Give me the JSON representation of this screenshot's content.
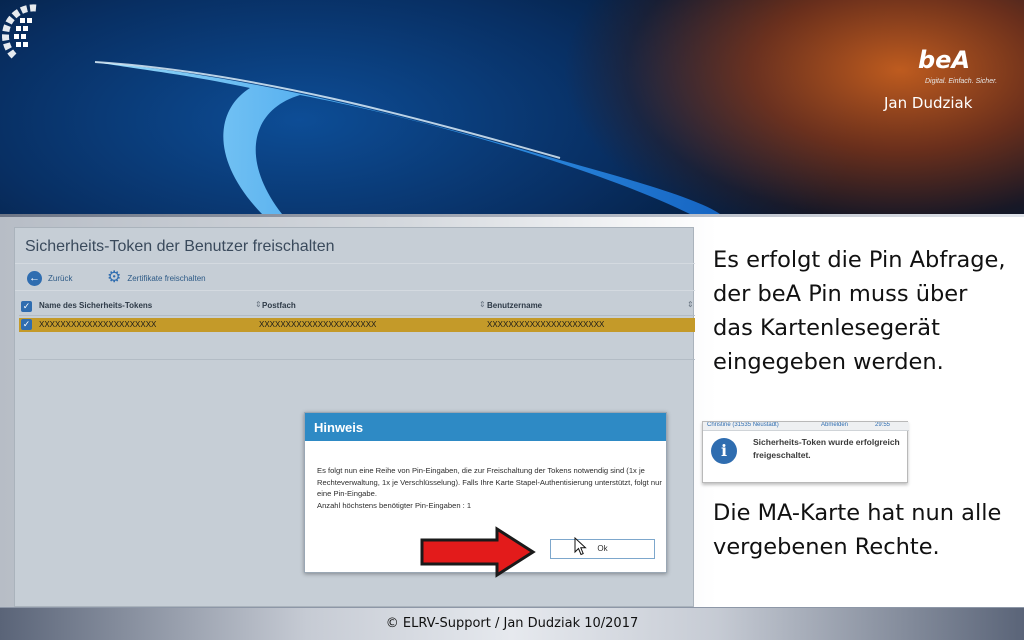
{
  "brand": {
    "logo_text": "beA",
    "tagline": "Digital. Einfach. Sicher.",
    "author": "Jan Dudziak"
  },
  "app": {
    "title": "Sicherheits-Token der Benutzer freischalten",
    "toolbar": {
      "back_label": "Zurück",
      "unlock_label": "Zertifikate freischalten"
    },
    "grid": {
      "columns": [
        "Name des Sicherheits-Tokens",
        "Postfach",
        "Benutzername"
      ],
      "rows": [
        [
          "XXXXXXXXXXXXXXXXXXXXXX",
          "XXXXXXXXXXXXXXXXXXXXXX",
          "XXXXXXXXXXXXXXXXXXXXXX"
        ]
      ]
    }
  },
  "dialog": {
    "title": "Hinweis",
    "body": "Es folgt nun eine Reihe von Pin-Eingaben, die zur Freischaltung der Tokens notwendig sind (1x je Rechteverwaltung, 1x je Verschlüsselung). Falls Ihre Karte Stapel-Authentisierung unterstützt, folgt nur eine Pin-Eingabe.",
    "count_line": "Anzahl höchstens benötigter Pin-Eingaben : 1",
    "ok_label": "Ok"
  },
  "notification": {
    "top_user": "Christine (31535 Neustadt)",
    "top_logout": "Abmelden",
    "top_time": "29:55",
    "message": "Sicherheits-Token wurde erfolgreich freigeschaltet."
  },
  "slide": {
    "text_pin": "Es erfolgt die Pin Abfrage, der beA Pin muss über das Kartenlesegerät eingegeben werden.",
    "text_rights": "Die MA-Karte hat nun alle vergebenen Rechte."
  },
  "footer": {
    "text": "© ELRV-Support / Jan Dudziak 10/2017"
  },
  "colors": {
    "accent_blue": "#2e8ac5",
    "row_highlight": "#c49a29",
    "arrow_red": "#e31b1b"
  }
}
